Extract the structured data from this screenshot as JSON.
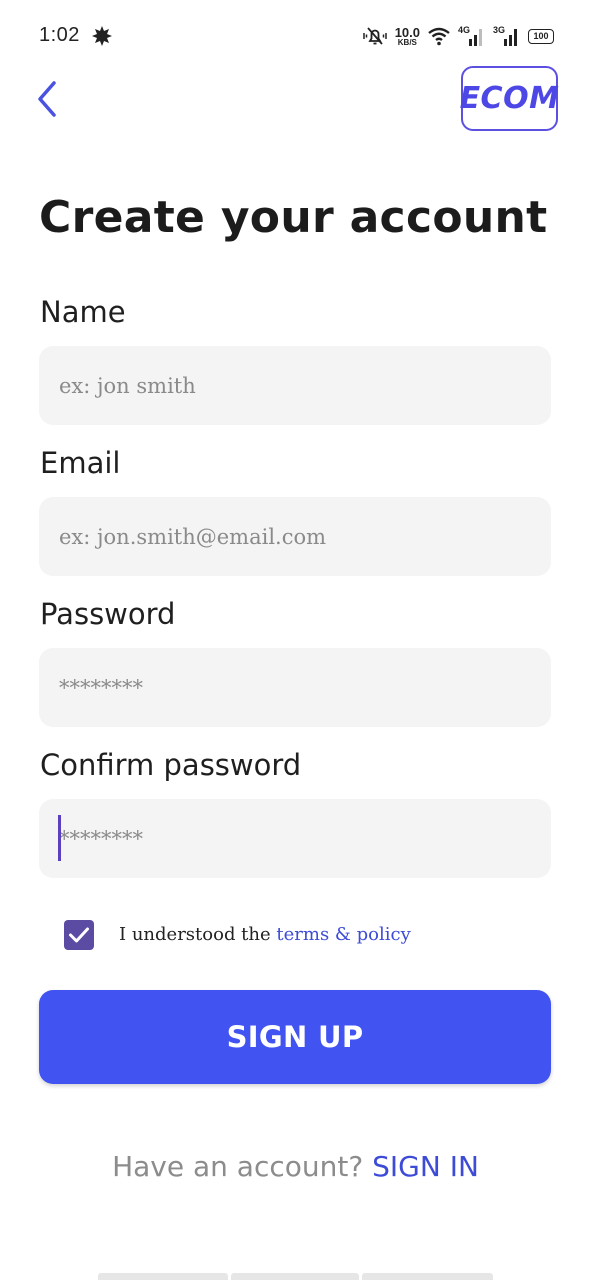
{
  "status_bar": {
    "time": "1:02",
    "speed_value": "10.0",
    "speed_unit": "KB/S",
    "net_1": "4G",
    "net_2": "3G",
    "battery": "100"
  },
  "header": {
    "logo_text": "ECOM"
  },
  "page": {
    "title": "Create your account"
  },
  "form": {
    "name": {
      "label": "Name",
      "placeholder": "ex: jon smith",
      "value": ""
    },
    "email": {
      "label": "Email",
      "placeholder": "ex: jon.smith@email.com",
      "value": ""
    },
    "password": {
      "label": "Password",
      "placeholder": "********",
      "value": ""
    },
    "confirm_password": {
      "label": "Confirm password",
      "placeholder": "********",
      "value": ""
    },
    "terms": {
      "checked": true,
      "prefix": "I understood the ",
      "link": "terms & policy"
    },
    "submit_label": "SIGN UP"
  },
  "footer": {
    "prompt": "Have an account? ",
    "signin_label": "SIGN IN"
  },
  "colors": {
    "accent": "#4154f1",
    "link": "#3d4bd6",
    "checkbox": "#5b4ba3",
    "field_bg": "#f4f4f4"
  },
  "icons": {
    "back": "chevron-left-icon",
    "status_leaf": "leaf-icon",
    "mute": "bell-off-icon",
    "wifi": "wifi-icon",
    "signal": "signal-bars-icon",
    "check": "checkmark-icon"
  }
}
